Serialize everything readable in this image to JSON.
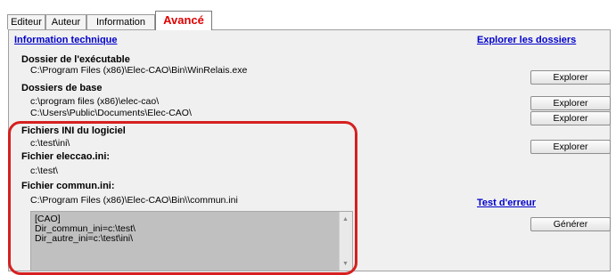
{
  "tabs": [
    "Editeur",
    "Auteur",
    "Information",
    "Avancé"
  ],
  "panel": {
    "info_title": "Information technique",
    "explore_title": "Explorer les dossiers",
    "test_title": "Test d'erreur"
  },
  "sections": {
    "exe_label": "Dossier de l'exécutable",
    "exe_path": "C:\\Program Files (x86)\\Elec-CAO\\Bin\\WinRelais.exe",
    "base_label": "Dossiers de base",
    "base_path1": "c:\\program files (x86)\\elec-cao\\",
    "base_path2": "C:\\Users\\Public\\Documents\\Elec-CAO\\",
    "ini_label": "Fichiers INI du logiciel",
    "ini_path": "c:\\test\\ini\\",
    "eleccao_label": "Fichier eleccao.ini:",
    "eleccao_path": "c:\\test\\",
    "commun_label": "Fichier commun.ini:",
    "commun_path": "C:\\Program Files (x86)\\Elec-CAO\\Bin\\\\commun.ini"
  },
  "buttons": {
    "explorer": "Explorer",
    "generer": "Générer"
  },
  "textarea_lines": [
    "[CAO]",
    "Dir_commun_ini=c:\\test\\",
    "Dir_autre_ini=c:\\test\\ini\\"
  ],
  "colors": {
    "highlight": "#d62020",
    "link": "#0000cc",
    "active_tab": "#e00000"
  }
}
